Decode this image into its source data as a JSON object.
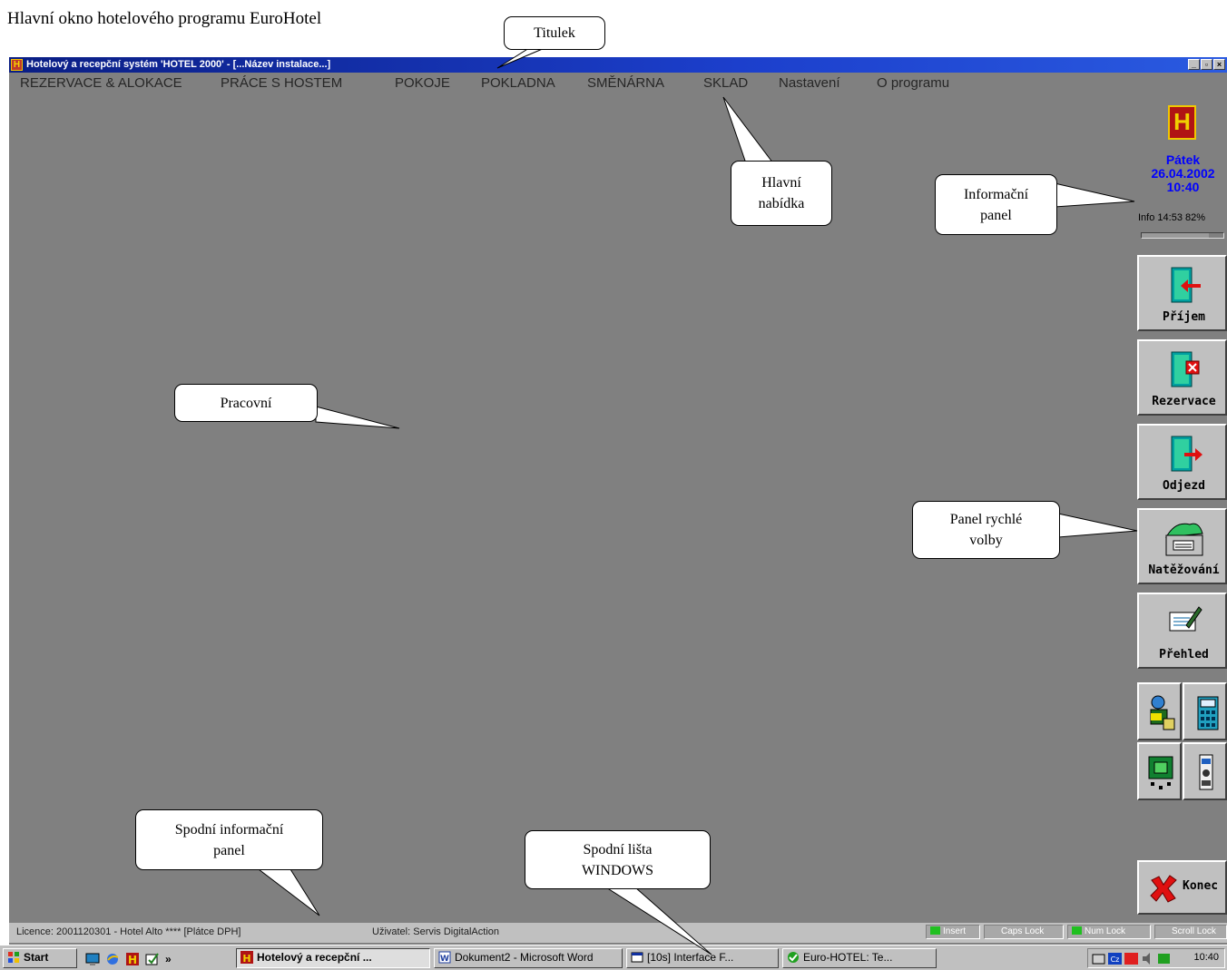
{
  "caption": "Hlavní okno hotelového programu EuroHotel",
  "window": {
    "title": "Hotelový a recepční systém 'HOTEL 2000' - [...Název instalace...]",
    "menu": [
      "REZERVACE & ALOKACE",
      "PRÁCE S HOSTEM",
      "POKOJE",
      "POKLADNA",
      "SMĚNÁRNA",
      "SKLAD",
      "Nastavení",
      "O programu"
    ]
  },
  "info_panel": {
    "logo": "H",
    "day": "Pátek",
    "date": "26.04.2002",
    "time": "10:40",
    "info_line": "Info 14:53  82%",
    "progress_percent": 82
  },
  "quick_panel": {
    "buttons": [
      {
        "label": "Příjem",
        "icon": "arrival-door-icon"
      },
      {
        "label": "Rezervace",
        "icon": "reservation-door-icon"
      },
      {
        "label": "Odjezd",
        "icon": "departure-door-icon"
      },
      {
        "label": "Natěžování",
        "icon": "loading-printer-icon"
      },
      {
        "label": "Přehled",
        "icon": "overview-pen-icon"
      }
    ],
    "small_buttons": [
      "person-card-icon",
      "calculator-icon",
      "circuit-board-icon",
      "phone-device-icon"
    ],
    "exit_label": "Konec"
  },
  "status": {
    "licence": "Licence: 2001120301 - Hotel Alto **** [Plátce DPH]",
    "user": "Uživatel: Servis DigitalAction",
    "indicators": [
      {
        "label": "Insert",
        "on": true
      },
      {
        "label": "Caps Lock",
        "on": false
      },
      {
        "label": "Num Lock",
        "on": true
      },
      {
        "label": "Scroll Lock",
        "on": false
      }
    ]
  },
  "taskbar": {
    "start": "Start",
    "tasks": [
      "Hotelový a recepční ...",
      "Dokument2 - Microsoft Word",
      "[10s] Interface F...",
      "Euro-HOTEL: Te..."
    ],
    "clock": "10:40",
    "chevron": "»"
  },
  "callouts": {
    "titulek": "Titulek",
    "hlavni_nabidka": "Hlavní\nnabídka",
    "informacni_panel": "Informační\npanel",
    "pracovni": "Pracovní",
    "panel_rychle_volby": "Panel rychlé\nvolby",
    "spodni_informacni_panel": "Spodní informační\npanel",
    "spodni_lista": "Spodní lišta\nWINDOWS"
  }
}
